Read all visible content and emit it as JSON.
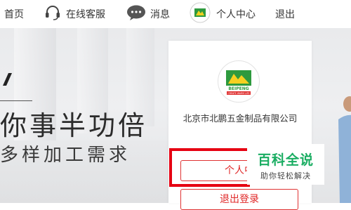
{
  "nav": {
    "home_label": "首页",
    "service_label": "在线客服",
    "messages_label": "消息",
    "profile_label": "个人中心",
    "logout_label": "退出"
  },
  "banner": {
    "slogan_line1": "你事半功倍",
    "slogan_line2": "多样加工需求"
  },
  "panel": {
    "logo_text_top": "BEIPENG",
    "logo_text_bottom": "CREATE WARM LIFE",
    "company_name": "北京市北鹏五金制品有限公司",
    "personal_center_button": "个人中",
    "logout_button": "退出登录"
  },
  "watermark": {
    "title": "百科全说",
    "subtitle": "助你轻松解决"
  },
  "colors": {
    "accent_red": "#e02828",
    "badge_green": "#1aad62",
    "logo_green": "#2e9a3e"
  }
}
